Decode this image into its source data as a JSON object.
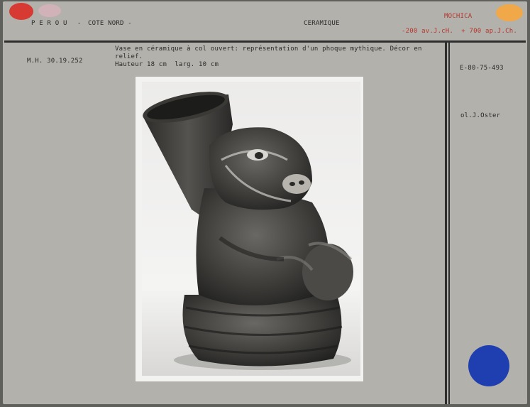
{
  "header": {
    "country": "P E R O U",
    "sep1": "-",
    "region": "COTE NORD -",
    "category": "CERAMIQUE",
    "culture": "MOCHICA",
    "dates": "-200 av.J.cH.  + 700 ap.J.Ch."
  },
  "record": {
    "inventory": "M.H. 30.19.252",
    "description_line1": "Vase en céramique à col ouvert: représentation d'un phoque mythique. Décor en",
    "description_line2": "relief.",
    "dimensions": "Hauteur 18 cm  larg. 10 cm",
    "photo_ref": "E-80-75-493",
    "collection": "ol.J.Oster"
  },
  "colors": {
    "card": "#b3b1ab",
    "dot_red": "#d63a32",
    "dot_pink": "#d9b3bd",
    "dot_orange": "#f0a848",
    "dot_blue": "#1f3fb0",
    "ink_red": "#b4352c"
  }
}
